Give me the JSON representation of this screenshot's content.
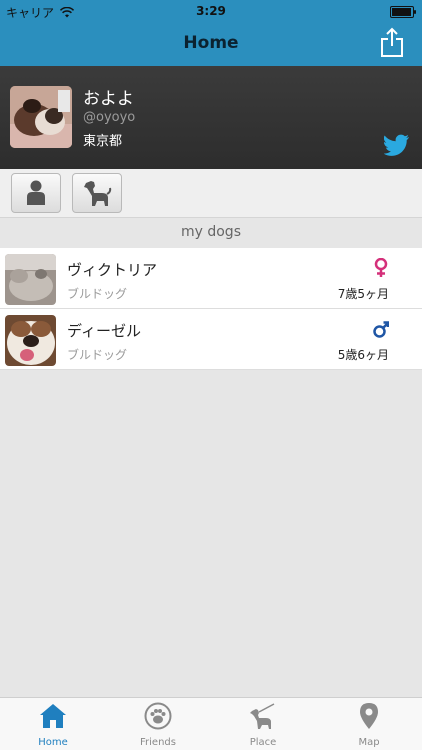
{
  "status": {
    "carrier": "キャリア",
    "time": "3:29"
  },
  "nav": {
    "title": "Home"
  },
  "profile": {
    "name": "およよ",
    "handle": "@oyoyo",
    "location": "東京都"
  },
  "section": {
    "title": "my dogs"
  },
  "dogs": [
    {
      "name": "ヴィクトリア",
      "breed": "ブルドッグ",
      "age": "7歳5ヶ月",
      "gender": "female",
      "gender_color": "#d4307a"
    },
    {
      "name": "ディーゼル",
      "breed": "ブルドッグ",
      "age": "5歳6ヶ月",
      "gender": "male",
      "gender_color": "#1f56a5"
    }
  ],
  "tabs": [
    {
      "label": "Home",
      "icon": "house-icon",
      "active": true
    },
    {
      "label": "Friends",
      "icon": "paw-icon",
      "active": false
    },
    {
      "label": "Place",
      "icon": "dog-walk-icon",
      "active": false
    },
    {
      "label": "Map",
      "icon": "map-pin-icon",
      "active": false
    }
  ],
  "colors": {
    "nav": "#2b8fbe",
    "active_tab": "#1f7fbf"
  }
}
